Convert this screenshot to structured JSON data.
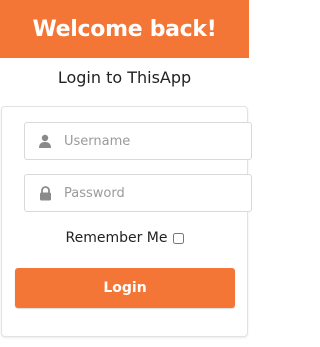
{
  "header": {
    "title": "Welcome back!"
  },
  "subtitle": "Login to ThisApp",
  "form": {
    "username_placeholder": "Username",
    "password_placeholder": "Password",
    "username_icon": "user-icon",
    "password_icon": "lock-icon",
    "remember_label": "Remember Me",
    "remember_checked": false,
    "login_label": "Login"
  },
  "colors": {
    "accent": "#f47636",
    "icon": "#8a8a8a"
  }
}
